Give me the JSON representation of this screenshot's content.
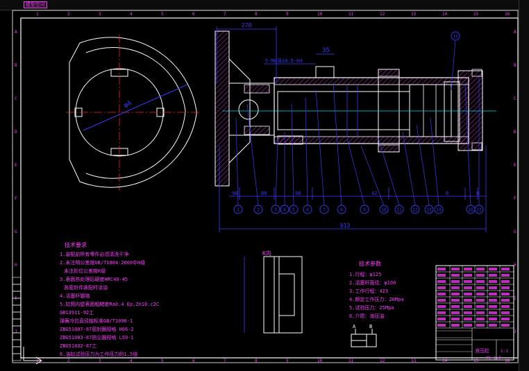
{
  "view_tab": "模型空间",
  "border_numbers": [
    "1",
    "2",
    "3",
    "4",
    "5",
    "6",
    "7",
    "8",
    "9",
    "10",
    "11",
    "12",
    "13",
    "14",
    "15",
    "16"
  ],
  "border_letters": [
    "A",
    "B",
    "C",
    "D",
    "E",
    "F",
    "G",
    "H",
    "I",
    "J"
  ],
  "section_label": "A-A",
  "detail_label": "K向",
  "dimensions": {
    "total_top": "270",
    "d35": "35",
    "thread": "5-M8深10.5-6H",
    "d96": "96",
    "d60": "60",
    "d98": "98",
    "d42": "42",
    "d6": "6",
    "d6b": "6",
    "overall": "813",
    "d_phi": "φA"
  },
  "balloons": [
    "1",
    "2",
    "3",
    "4",
    "5",
    "6",
    "7",
    "8",
    "9",
    "10",
    "11",
    "12",
    "13",
    "14",
    "15",
    "16",
    "17"
  ],
  "notes_left": {
    "title": "技术要求",
    "lines": [
      "1.装配前所有零件必须清洗干净",
      "2.未注明公差按GB/T1804-2000中m级",
      "未注形位公差按K级",
      "3.表面热处理后硬度HRC40-45",
      "各密封件装配时涂油",
      "4.活塞杆镀铬",
      "5.缸筒内壁表面粗糙度Ra0.4  Ep.Zn10.c2C",
      "GB13911-92工",
      "弹簧冷拉直径按标准GB/T1096-1",
      "ZBG51007-87密封圈规格 H06-2",
      "ZBG51003-87防尘圈规格 L50-1",
      "ZBG51032-87工",
      "6.油缸试验压力为工作压力的1.5倍"
    ]
  },
  "notes_right": {
    "title": "技术参数",
    "lines": [
      "1.行程：φ125",
      "2.活塞杆直径：φ100",
      "3.工作行程：423",
      "4.额定工作压力：20Mpa",
      "5.试验压力：25Mpa",
      "6.介质：液压油"
    ]
  },
  "hydraulic_symbol": {
    "port_a": "A",
    "port_b": "B"
  },
  "title_block": {
    "drawing_name": "液压缸",
    "drawing_no": "YG-1.0",
    "scale": "1:1"
  },
  "colors": {
    "outline": "#ffffff",
    "dimension": "#3a3aff",
    "text": "#ff3cff",
    "center": "#ff2020",
    "hatch": "#ff3cff",
    "aux": "#00e0e0"
  }
}
